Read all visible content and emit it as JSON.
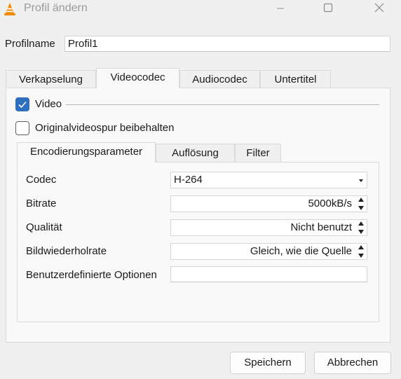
{
  "window": {
    "title": "Profil ändern",
    "icon": "vlc-cone-icon",
    "controls": [
      "minimize-icon",
      "maximize-icon",
      "close-icon"
    ]
  },
  "profile": {
    "name_label": "Profilname",
    "name_value": "Profil1"
  },
  "tabs": [
    {
      "label": "Verkapselung",
      "active": false
    },
    {
      "label": "Videocodec",
      "active": true
    },
    {
      "label": "Audiocodec",
      "active": false
    },
    {
      "label": "Untertitel",
      "active": false
    }
  ],
  "video": {
    "video_label": "Video",
    "video_checked": true,
    "keep_original_label": "Originalvideospur beibehalten",
    "keep_original_checked": false
  },
  "subtabs": [
    {
      "label": "Encodierungsparameter",
      "active": true
    },
    {
      "label": "Auflösung",
      "active": false
    },
    {
      "label": "Filter",
      "active": false
    }
  ],
  "params": {
    "codec_label": "Codec",
    "codec_value": "H-264",
    "bitrate_label": "Bitrate",
    "bitrate_value": "5000kB/s",
    "quality_label": "Qualität",
    "quality_value": "Nicht benutzt",
    "framerate_label": "Bildwiederholrate",
    "framerate_value": "Gleich, wie die Quelle",
    "custom_label": "Benutzerdefinierte Optionen",
    "custom_value": ""
  },
  "buttons": {
    "save": "Speichern",
    "cancel": "Abbrechen"
  },
  "colors": {
    "accent": "#2f6fbf",
    "window_bg": "#f0f0f0",
    "panel_bg": "#f9f9f9"
  }
}
